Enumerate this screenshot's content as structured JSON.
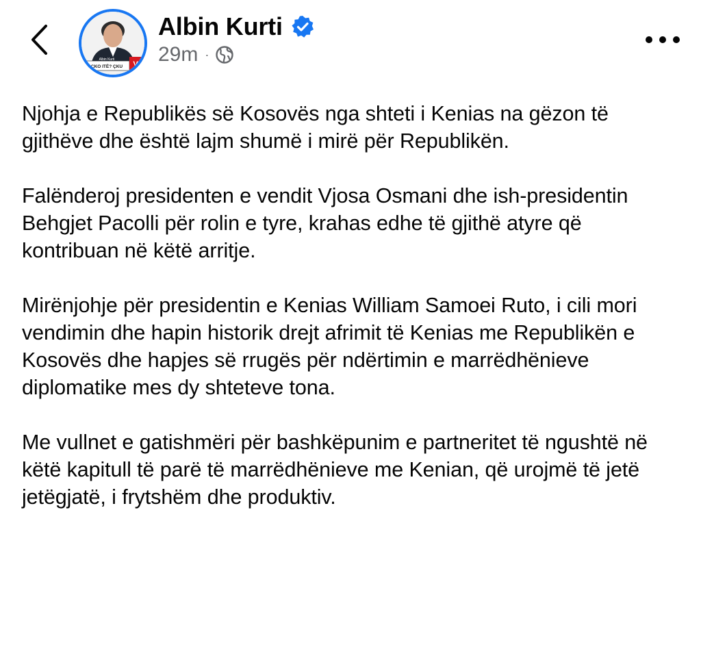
{
  "author": {
    "name": "Albin Kurti",
    "time": "29m",
    "separator": "·",
    "verified": true,
    "privacy_icon": "globe-icon",
    "avatar_caption": "Albin Kurti",
    "avatar_banner": "ÇKO ITË? ÇKU",
    "avatar_badge": "V"
  },
  "icons": {
    "back": "chevron-left-icon",
    "more": "more-horizontal-icon",
    "verified": "verified-badge-icon"
  },
  "colors": {
    "accent": "#1877f2",
    "text": "#050505",
    "meta": "#65676b",
    "brand_red": "#d71920"
  },
  "post": {
    "paragraphs": [
      "Njohja e Republikës së Kosovës nga shteti i Kenias na gëzon të gjithëve dhe është lajm shumë i mirë për Republikën.",
      "Falënderoj presidenten e vendit Vjosa Osmani dhe ish-presidentin Behgjet Pacolli për rolin e tyre, krahas edhe të gjithë atyre që kontribuan në këtë arritje.",
      "Mirënjohje për presidentin e Kenias William Samoei Ruto, i cili mori vendimin dhe hapin historik drejt afrimit të Kenias me Republikën e Kosovës dhe hapjes së rrugës për ndërtimin e marrëdhënieve diplomatike mes dy shteteve tona.",
      "Me vullnet e gatishmëri për bashkëpunim e partneritet të ngushtë në këtë kapitull të parë të marrëdhënieve me Kenian, që urojmë të jetë jetëgjatë, i frytshëm dhe produktiv."
    ]
  }
}
